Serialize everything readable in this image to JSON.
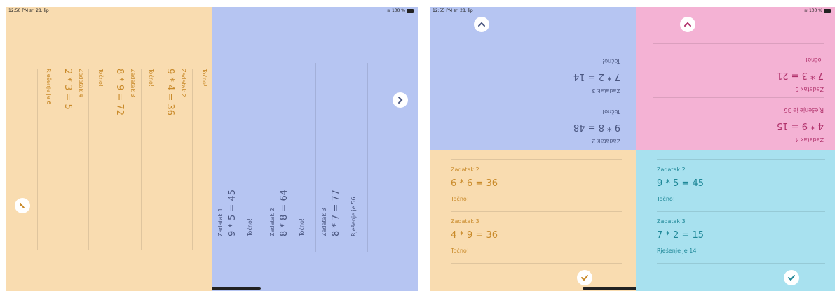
{
  "left": {
    "status_time": "12:50 PM  sri 28. lip",
    "status_right": "100 %",
    "peach_items": [
      {
        "label": "Zadatak 2",
        "equation": "9 * 4 = 36",
        "result": "Točno!"
      },
      {
        "label": "Zadatak 3",
        "equation": "8 * 9 = 72",
        "result": "Točno!"
      },
      {
        "label": "Zadatak 4",
        "equation": "2 * 3 = 5",
        "result": "Rješenje je 6"
      }
    ],
    "peach_top_result": "Točno!",
    "blue_items": [
      {
        "label": "Zadatak 1",
        "equation": "9 * 5 = 45",
        "result": "Točno!"
      },
      {
        "label": "Zadatak 2",
        "equation": "8 * 8 = 64",
        "result": "Točno!"
      },
      {
        "label": "Zadatak 3",
        "equation": "8 * 7 = 77",
        "result": "Rješenje je 56"
      }
    ]
  },
  "right": {
    "status_time": "12:55 PM  sri 28. lip",
    "status_right": "100 %",
    "blue_items": [
      {
        "label": "Zadatak 2",
        "equation": "9 * 8 = 48",
        "result": "Točno!"
      },
      {
        "label": "Zadatak 3",
        "equation": "7 * 2 = 14",
        "result": "Točno!"
      }
    ],
    "pink_items": [
      {
        "label": "Zadatak 4",
        "equation": "4 * 9 = 15",
        "result": "Rješenje je 36"
      },
      {
        "label": "Zadatak 5",
        "equation": "7 * 3 = 21",
        "result": "Točno!"
      }
    ],
    "peach_items": [
      {
        "label": "Zadatak 2",
        "equation": "6 * 6 = 36",
        "result": "Točno!"
      },
      {
        "label": "Zadatak 3",
        "equation": "4 * 9 = 36",
        "result": "Točno!"
      }
    ],
    "cyan_items": [
      {
        "label": "Zadatak 2",
        "equation": "9 * 5 = 45",
        "result": "Točno!"
      },
      {
        "label": "Zadatak 3",
        "equation": "7 * 2 = 15",
        "result": "Rješenje je 14"
      }
    ]
  },
  "colors": {
    "peach": "#f9dcb0",
    "blue": "#b6c5f2",
    "pink": "#f4b2d4",
    "cyan": "#a8e1ef",
    "peach_text": "#c98a2a",
    "blue_text": "#4a5680",
    "pink_text": "#b0306a",
    "cyan_text": "#1e8797"
  },
  "icons": [
    "chevron-icon",
    "wifi-icon",
    "battery-icon",
    "checkmark-icon"
  ]
}
